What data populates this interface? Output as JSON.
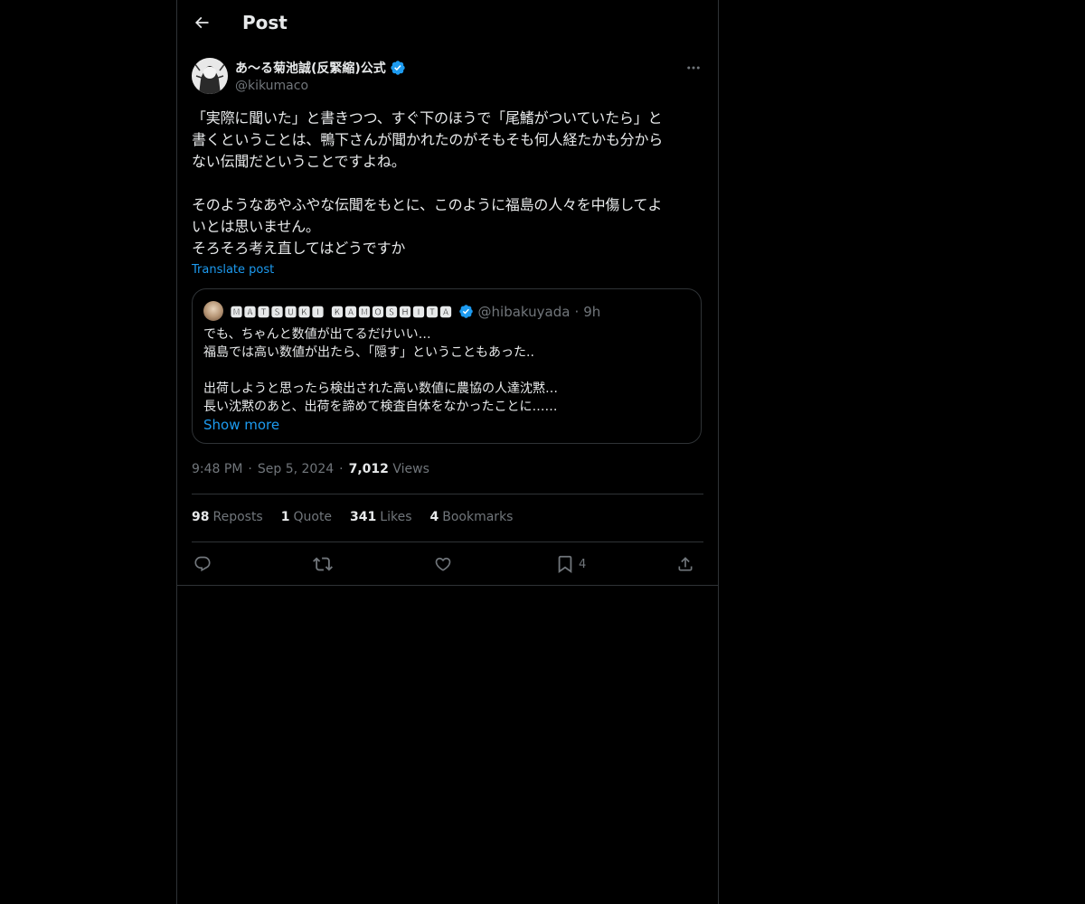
{
  "header": {
    "title": "Post",
    "back_icon": "arrow-left-icon"
  },
  "author": {
    "name": "あ〜る菊池誠(反緊縮)公式",
    "handle": "@kikumaco",
    "verified": true
  },
  "tweet": {
    "text": "「実際に聞いた」と書きつつ、すぐ下のほうで「尾鰭がついていたら」と\n書くということは、鴨下さんが聞かれたのがそもそも何人経たかも分から\nない伝聞だということですよね。\n\nそのようなあやふやな伝聞をもとに、このように福島の人々を中傷してよ\nいとは思いません。\nそろそろ考え直してはどうですか",
    "translate_label": "Translate post"
  },
  "quote": {
    "name": "🅼🅰🆃🆂🆄🅺🅸 🅺🅰🅼🅾🆂🅷🅸🆃🅰",
    "handle": "@hibakuyada",
    "dot": "·",
    "time": "9h",
    "text": "でも、ちゃんと数値が出てるだけいい…\n福島では高い数値が出たら、「隠す」ということもあった..\n\n出荷しようと思ったら検出された高い数値に農協の人達沈黙…\n長い沈黙のあと、出荷を諦めて検査自体をなかったことに……",
    "show_more": "Show more"
  },
  "meta": {
    "time": "9:48 PM",
    "sep1": "·",
    "date": "Sep 5, 2024",
    "sep2": "·",
    "views_count": "7,012",
    "views_label": "Views"
  },
  "stats": {
    "reposts_count": "98",
    "reposts_label": "Reposts",
    "quotes_count": "1",
    "quotes_label": "Quote",
    "likes_count": "341",
    "likes_label": "Likes",
    "bookmarks_count": "4",
    "bookmarks_label": "Bookmarks"
  },
  "actions": {
    "reply_icon": "reply-icon",
    "repost_icon": "repost-icon",
    "like_icon": "heart-icon",
    "bookmark_icon": "bookmark-icon",
    "bookmark_count": "4",
    "share_icon": "share-icon"
  },
  "colors": {
    "background": "#000000",
    "text": "#e7e9ea",
    "secondary": "#71767b",
    "accent": "#1d9bf0",
    "border": "#2f3336"
  }
}
